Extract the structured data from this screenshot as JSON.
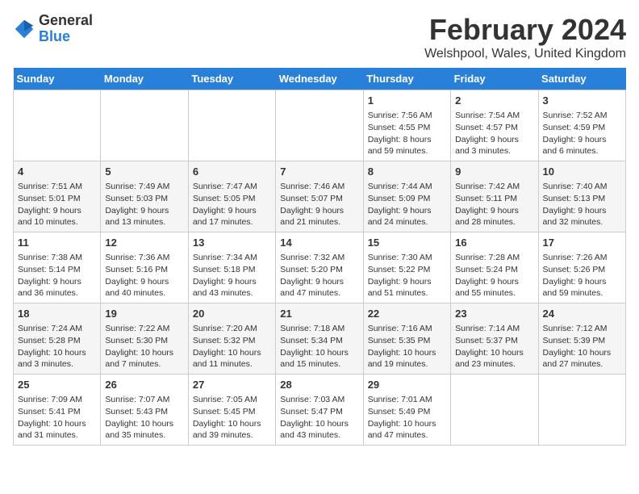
{
  "header": {
    "logo_general": "General",
    "logo_blue": "Blue",
    "main_title": "February 2024",
    "subtitle": "Welshpool, Wales, United Kingdom"
  },
  "days_of_week": [
    "Sunday",
    "Monday",
    "Tuesday",
    "Wednesday",
    "Thursday",
    "Friday",
    "Saturday"
  ],
  "weeks": [
    {
      "cells": [
        {
          "date": "",
          "empty": true
        },
        {
          "date": "",
          "empty": true
        },
        {
          "date": "",
          "empty": true
        },
        {
          "date": "",
          "empty": true
        },
        {
          "date": "1",
          "sunrise": "7:56 AM",
          "sunset": "4:55 PM",
          "daylight": "8 hours and 59 minutes."
        },
        {
          "date": "2",
          "sunrise": "7:54 AM",
          "sunset": "4:57 PM",
          "daylight": "9 hours and 3 minutes."
        },
        {
          "date": "3",
          "sunrise": "7:52 AM",
          "sunset": "4:59 PM",
          "daylight": "9 hours and 6 minutes."
        }
      ]
    },
    {
      "cells": [
        {
          "date": "4",
          "sunrise": "7:51 AM",
          "sunset": "5:01 PM",
          "daylight": "9 hours and 10 minutes."
        },
        {
          "date": "5",
          "sunrise": "7:49 AM",
          "sunset": "5:03 PM",
          "daylight": "9 hours and 13 minutes."
        },
        {
          "date": "6",
          "sunrise": "7:47 AM",
          "sunset": "5:05 PM",
          "daylight": "9 hours and 17 minutes."
        },
        {
          "date": "7",
          "sunrise": "7:46 AM",
          "sunset": "5:07 PM",
          "daylight": "9 hours and 21 minutes."
        },
        {
          "date": "8",
          "sunrise": "7:44 AM",
          "sunset": "5:09 PM",
          "daylight": "9 hours and 24 minutes."
        },
        {
          "date": "9",
          "sunrise": "7:42 AM",
          "sunset": "5:11 PM",
          "daylight": "9 hours and 28 minutes."
        },
        {
          "date": "10",
          "sunrise": "7:40 AM",
          "sunset": "5:13 PM",
          "daylight": "9 hours and 32 minutes."
        }
      ]
    },
    {
      "cells": [
        {
          "date": "11",
          "sunrise": "7:38 AM",
          "sunset": "5:14 PM",
          "daylight": "9 hours and 36 minutes."
        },
        {
          "date": "12",
          "sunrise": "7:36 AM",
          "sunset": "5:16 PM",
          "daylight": "9 hours and 40 minutes."
        },
        {
          "date": "13",
          "sunrise": "7:34 AM",
          "sunset": "5:18 PM",
          "daylight": "9 hours and 43 minutes."
        },
        {
          "date": "14",
          "sunrise": "7:32 AM",
          "sunset": "5:20 PM",
          "daylight": "9 hours and 47 minutes."
        },
        {
          "date": "15",
          "sunrise": "7:30 AM",
          "sunset": "5:22 PM",
          "daylight": "9 hours and 51 minutes."
        },
        {
          "date": "16",
          "sunrise": "7:28 AM",
          "sunset": "5:24 PM",
          "daylight": "9 hours and 55 minutes."
        },
        {
          "date": "17",
          "sunrise": "7:26 AM",
          "sunset": "5:26 PM",
          "daylight": "9 hours and 59 minutes."
        }
      ]
    },
    {
      "cells": [
        {
          "date": "18",
          "sunrise": "7:24 AM",
          "sunset": "5:28 PM",
          "daylight": "10 hours and 3 minutes."
        },
        {
          "date": "19",
          "sunrise": "7:22 AM",
          "sunset": "5:30 PM",
          "daylight": "10 hours and 7 minutes."
        },
        {
          "date": "20",
          "sunrise": "7:20 AM",
          "sunset": "5:32 PM",
          "daylight": "10 hours and 11 minutes."
        },
        {
          "date": "21",
          "sunrise": "7:18 AM",
          "sunset": "5:34 PM",
          "daylight": "10 hours and 15 minutes."
        },
        {
          "date": "22",
          "sunrise": "7:16 AM",
          "sunset": "5:35 PM",
          "daylight": "10 hours and 19 minutes."
        },
        {
          "date": "23",
          "sunrise": "7:14 AM",
          "sunset": "5:37 PM",
          "daylight": "10 hours and 23 minutes."
        },
        {
          "date": "24",
          "sunrise": "7:12 AM",
          "sunset": "5:39 PM",
          "daylight": "10 hours and 27 minutes."
        }
      ]
    },
    {
      "cells": [
        {
          "date": "25",
          "sunrise": "7:09 AM",
          "sunset": "5:41 PM",
          "daylight": "10 hours and 31 minutes."
        },
        {
          "date": "26",
          "sunrise": "7:07 AM",
          "sunset": "5:43 PM",
          "daylight": "10 hours and 35 minutes."
        },
        {
          "date": "27",
          "sunrise": "7:05 AM",
          "sunset": "5:45 PM",
          "daylight": "10 hours and 39 minutes."
        },
        {
          "date": "28",
          "sunrise": "7:03 AM",
          "sunset": "5:47 PM",
          "daylight": "10 hours and 43 minutes."
        },
        {
          "date": "29",
          "sunrise": "7:01 AM",
          "sunset": "5:49 PM",
          "daylight": "10 hours and 47 minutes."
        },
        {
          "date": "",
          "empty": true
        },
        {
          "date": "",
          "empty": true
        }
      ]
    }
  ]
}
